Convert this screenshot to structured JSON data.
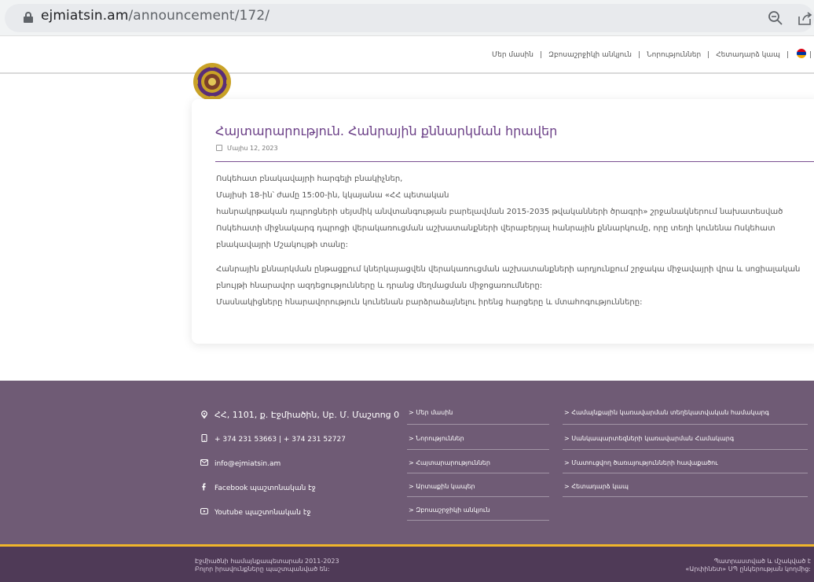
{
  "browser": {
    "url_domain": "ejmiatsin.am",
    "url_path": "/announcement/172/"
  },
  "header": {
    "nav": [
      "Մեր մասին",
      "Զբոսաշրջիկի անկյուն",
      "Նորություններ",
      "Հետադարձ կապ"
    ]
  },
  "article": {
    "title": "Հայտարարություն. Հանրային քննարկման հրավեր",
    "date": "Մայիս 12, 2023",
    "paragraph1": [
      "Ոսկեհատ բնակավայրի հարգելի բնակիչներ,",
      "Մայիսի 18-ին՝ ժամը 15:00-ին, կկայանա «ՀՀ պետական",
      "հանրակրթական դպրոցների սեյսմիկ անվտանգության բարելավման 2015-2035 թվականների ծրագրի» շրջանակներում նախատեսված",
      "Ոսկեհատի միջնակարգ դպրոցի վերակառուցման աշխատանքների վերաբերյալ հանրային քննարկումը, որը տեղի կունենա Ոսկեհատ",
      "բնակավայրի Մշակույթի տանը:"
    ],
    "paragraph2": [
      "Հանրային քննարկման ընթացքում կներկայացվեն վերակառուցման աշխատանքների արդյունքում շրջակա միջավայրի վրա և սոցիալական",
      "բնույթի հնարավոր ազդեցությունները և դրանց մեղմացման միջոցառումները:",
      "Մասնակիցները հնարավորություն կունենան բարձրաձայնելու իրենց հարցերը և մտահոգությունները:"
    ]
  },
  "footer": {
    "address": "ՀՀ, 1101, ք. Էջմիածին, Սբ. Մ. Մաշտոց 0",
    "phone": "+ 374 231 53663 | + 374 231 52727",
    "email": "info@ejmiatsin.am",
    "facebook": "Facebook պաշտոնական էջ",
    "youtube": "Youtube պաշտոնական էջ",
    "links_col1": [
      "> Մեր մասին",
      "> Նորություններ",
      "> Հայտարարություններ",
      "> Արտաքին կապեր",
      "> Զբոսաշրջիկի անկյուն"
    ],
    "links_col2": [
      "> Համայնքային կառավարման տեղեկատվական համակարգ",
      "> Սանկապարտեզների կառավարման Համակարգ",
      "> Մատուցվող ծառայությունների հավաքածու",
      "> Հետադարձ կապ"
    ],
    "copyright_line1": "Էջմիածնի համայնքապետարան 2011-2023",
    "copyright_line2": "Բոլոր իրավունքները պաշտպանված են:",
    "credit_line1": "Պատրաստված և մշակված է",
    "credit_line2": "«Արփինետ» ՍՊ ընկերության կողմից:"
  },
  "colors": {
    "accent": "#6a3e86",
    "footer_bg": "#6f5b75",
    "footer_bottom": "#4f3a57",
    "gold_line": "#f0b62b"
  }
}
